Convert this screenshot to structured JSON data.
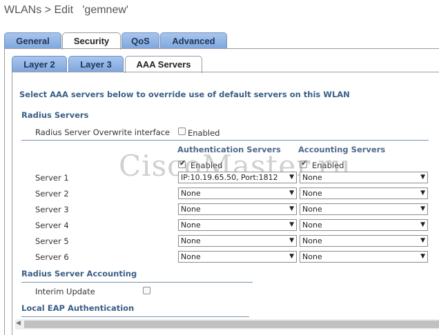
{
  "page": {
    "title": "WLANs > Edit   'gemnew'"
  },
  "main_tabs": [
    {
      "label": "General",
      "active": false
    },
    {
      "label": "Security",
      "active": true
    },
    {
      "label": "QoS",
      "active": false
    },
    {
      "label": "Advanced",
      "active": false
    }
  ],
  "sub_tabs": [
    {
      "label": "Layer 2",
      "active": false
    },
    {
      "label": "Layer 3",
      "active": false
    },
    {
      "label": "AAA Servers",
      "active": true
    }
  ],
  "intro": "Select AAA servers below to override use of default servers on this WLAN",
  "radius": {
    "heading": "Radius Servers",
    "overwrite_label": "Radius Server Overwrite interface",
    "overwrite_checkbox_label": "Enabled",
    "overwrite_checked": false,
    "auth_header": "Authentication Servers",
    "acct_header": "Accounting Servers",
    "auth_enabled_label": "Enabled",
    "auth_enabled": true,
    "acct_enabled_label": "Enabled",
    "acct_enabled": true,
    "servers": [
      {
        "label": "Server 1",
        "auth": "IP:10.19.65.50, Port:1812",
        "acct": "None"
      },
      {
        "label": "Server 2",
        "auth": "None",
        "acct": "None"
      },
      {
        "label": "Server 3",
        "auth": "None",
        "acct": "None"
      },
      {
        "label": "Server 4",
        "auth": "None",
        "acct": "None"
      },
      {
        "label": "Server 5",
        "auth": "None",
        "acct": "None"
      },
      {
        "label": "Server 6",
        "auth": "None",
        "acct": "None"
      }
    ]
  },
  "accounting": {
    "heading": "Radius Server Accounting",
    "interim_label": "Interim Update",
    "interim_checked": false
  },
  "eap": {
    "heading": "Local EAP Authentication"
  },
  "watermark": "CiscoMaster.ru"
}
